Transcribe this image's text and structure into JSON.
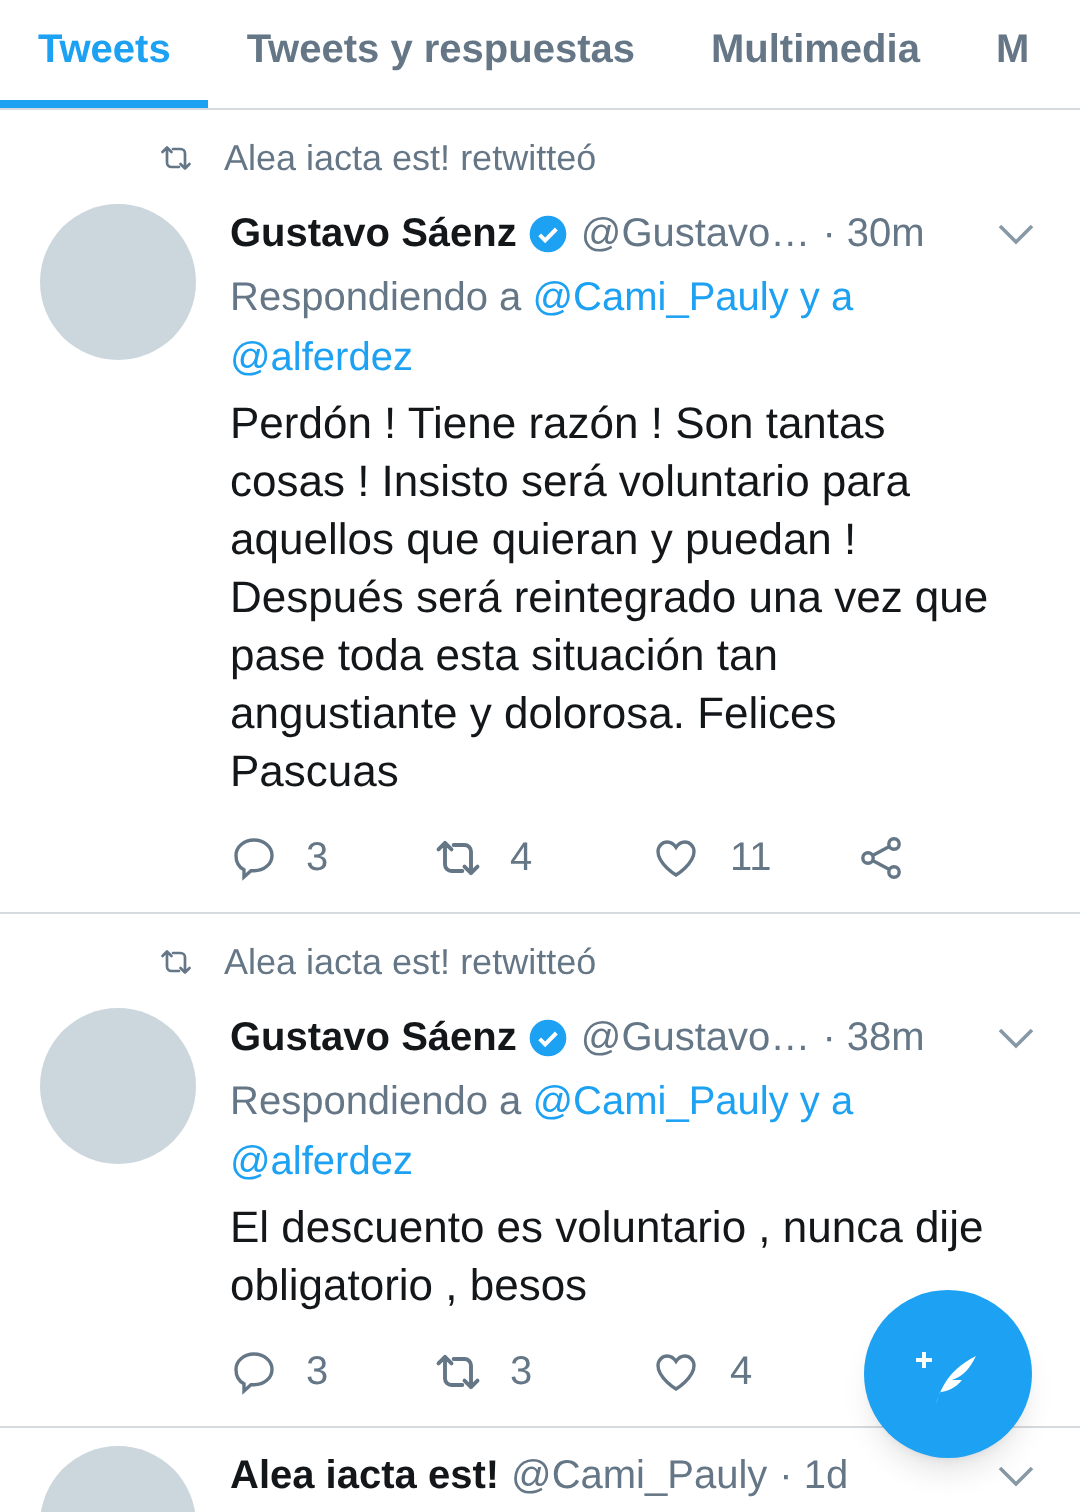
{
  "tabs": [
    {
      "label": "Tweets",
      "selected": true
    },
    {
      "label": "Tweets y respuestas",
      "selected": false
    },
    {
      "label": "Multimedia",
      "selected": false
    },
    {
      "label": "M",
      "selected": false
    }
  ],
  "tweets": [
    {
      "retweeted_by": "Alea iacta est! retwitteó",
      "name": "Gustavo Sáenz",
      "verified": true,
      "handle": "@Gustavo…",
      "time": "· 30m",
      "replying": {
        "label": "Respondiendo a",
        "mentions": [
          "@Cami_Pauly y a",
          "@alferdez"
        ]
      },
      "text": "Perdón ! Tiene razón ! Son tantas cosas ! Insisto será voluntario para aquellos que quieran y puedan ! Después será reintegrado una vez que pase toda esta situación tan angustiante y dolorosa. Felices Pascuas",
      "actions": {
        "replies": "3",
        "retweets": "4",
        "likes": "11",
        "share": true
      }
    },
    {
      "retweeted_by": "Alea iacta est! retwitteó",
      "name": "Gustavo Sáenz",
      "verified": true,
      "handle": "@Gustavo…",
      "time": "· 38m",
      "replying": {
        "label": "Respondiendo a",
        "mentions": [
          "@Cami_Pauly y a",
          "@alferdez"
        ]
      },
      "text": "El descuento es voluntario , nunca dije obligatorio , besos",
      "actions": {
        "replies": "3",
        "retweets": "3",
        "likes": "4",
        "share": false
      }
    },
    {
      "name": "Alea iacta est!",
      "verified": false,
      "handle": "@Cami_Pauly",
      "time": "· 1d"
    }
  ]
}
